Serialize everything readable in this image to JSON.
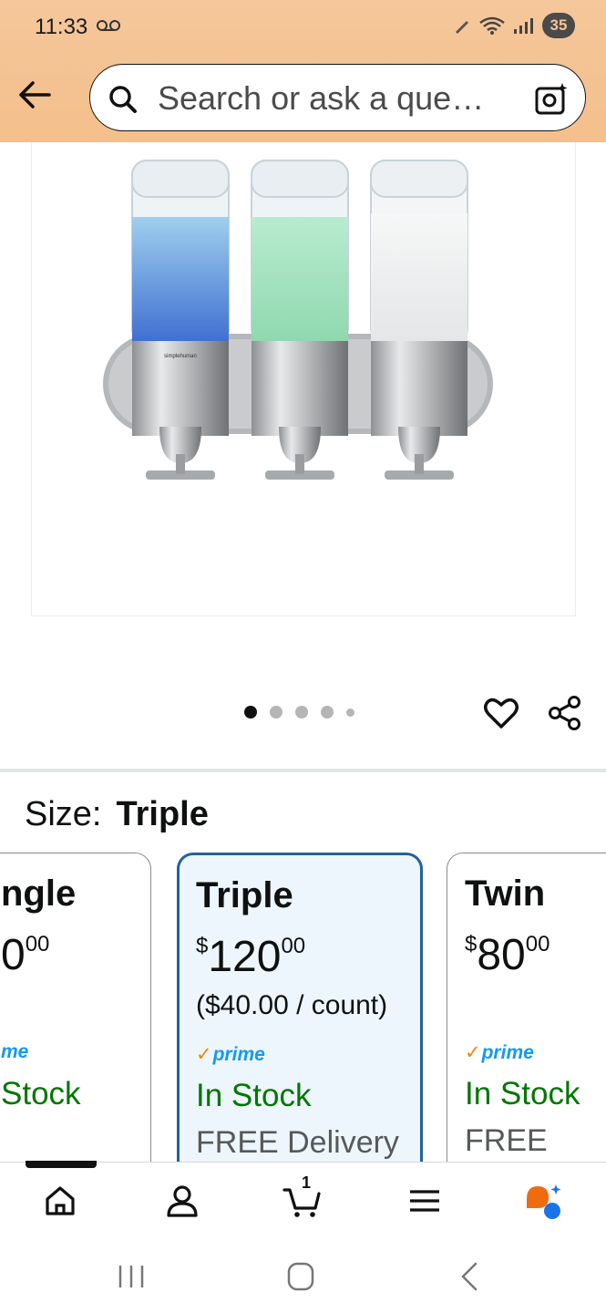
{
  "status_bar": {
    "time": "11:33",
    "battery": "35"
  },
  "search": {
    "placeholder": "Search or ask a que…"
  },
  "product": {
    "brand_label": "simplehuman"
  },
  "carousel": {
    "total": 5,
    "active": 0
  },
  "size": {
    "label": "Size:",
    "value": "Triple"
  },
  "cards": [
    {
      "title": "ngle",
      "price_whole": "0",
      "price_frac": "00",
      "prime": "me",
      "stock": "Stock"
    },
    {
      "title": "Triple",
      "price_currency": "$",
      "price_whole": "120",
      "price_frac": "00",
      "unit_price": "($40.00 / count)",
      "prime": "prime",
      "stock": "In Stock",
      "delivery": "FREE Delivery"
    },
    {
      "title": "Twin",
      "price_currency": "$",
      "price_whole": "80",
      "price_frac": "00",
      "prime": "prime",
      "stock": "In Stock",
      "delivery": "FREE"
    }
  ],
  "nav": {
    "cart_count": "1"
  },
  "colors": {
    "header": "#f4bf8b",
    "selected_border": "#2162a1",
    "stock_green": "#007600",
    "prime_blue": "#1399f4",
    "accent_orange": "#f08804"
  }
}
